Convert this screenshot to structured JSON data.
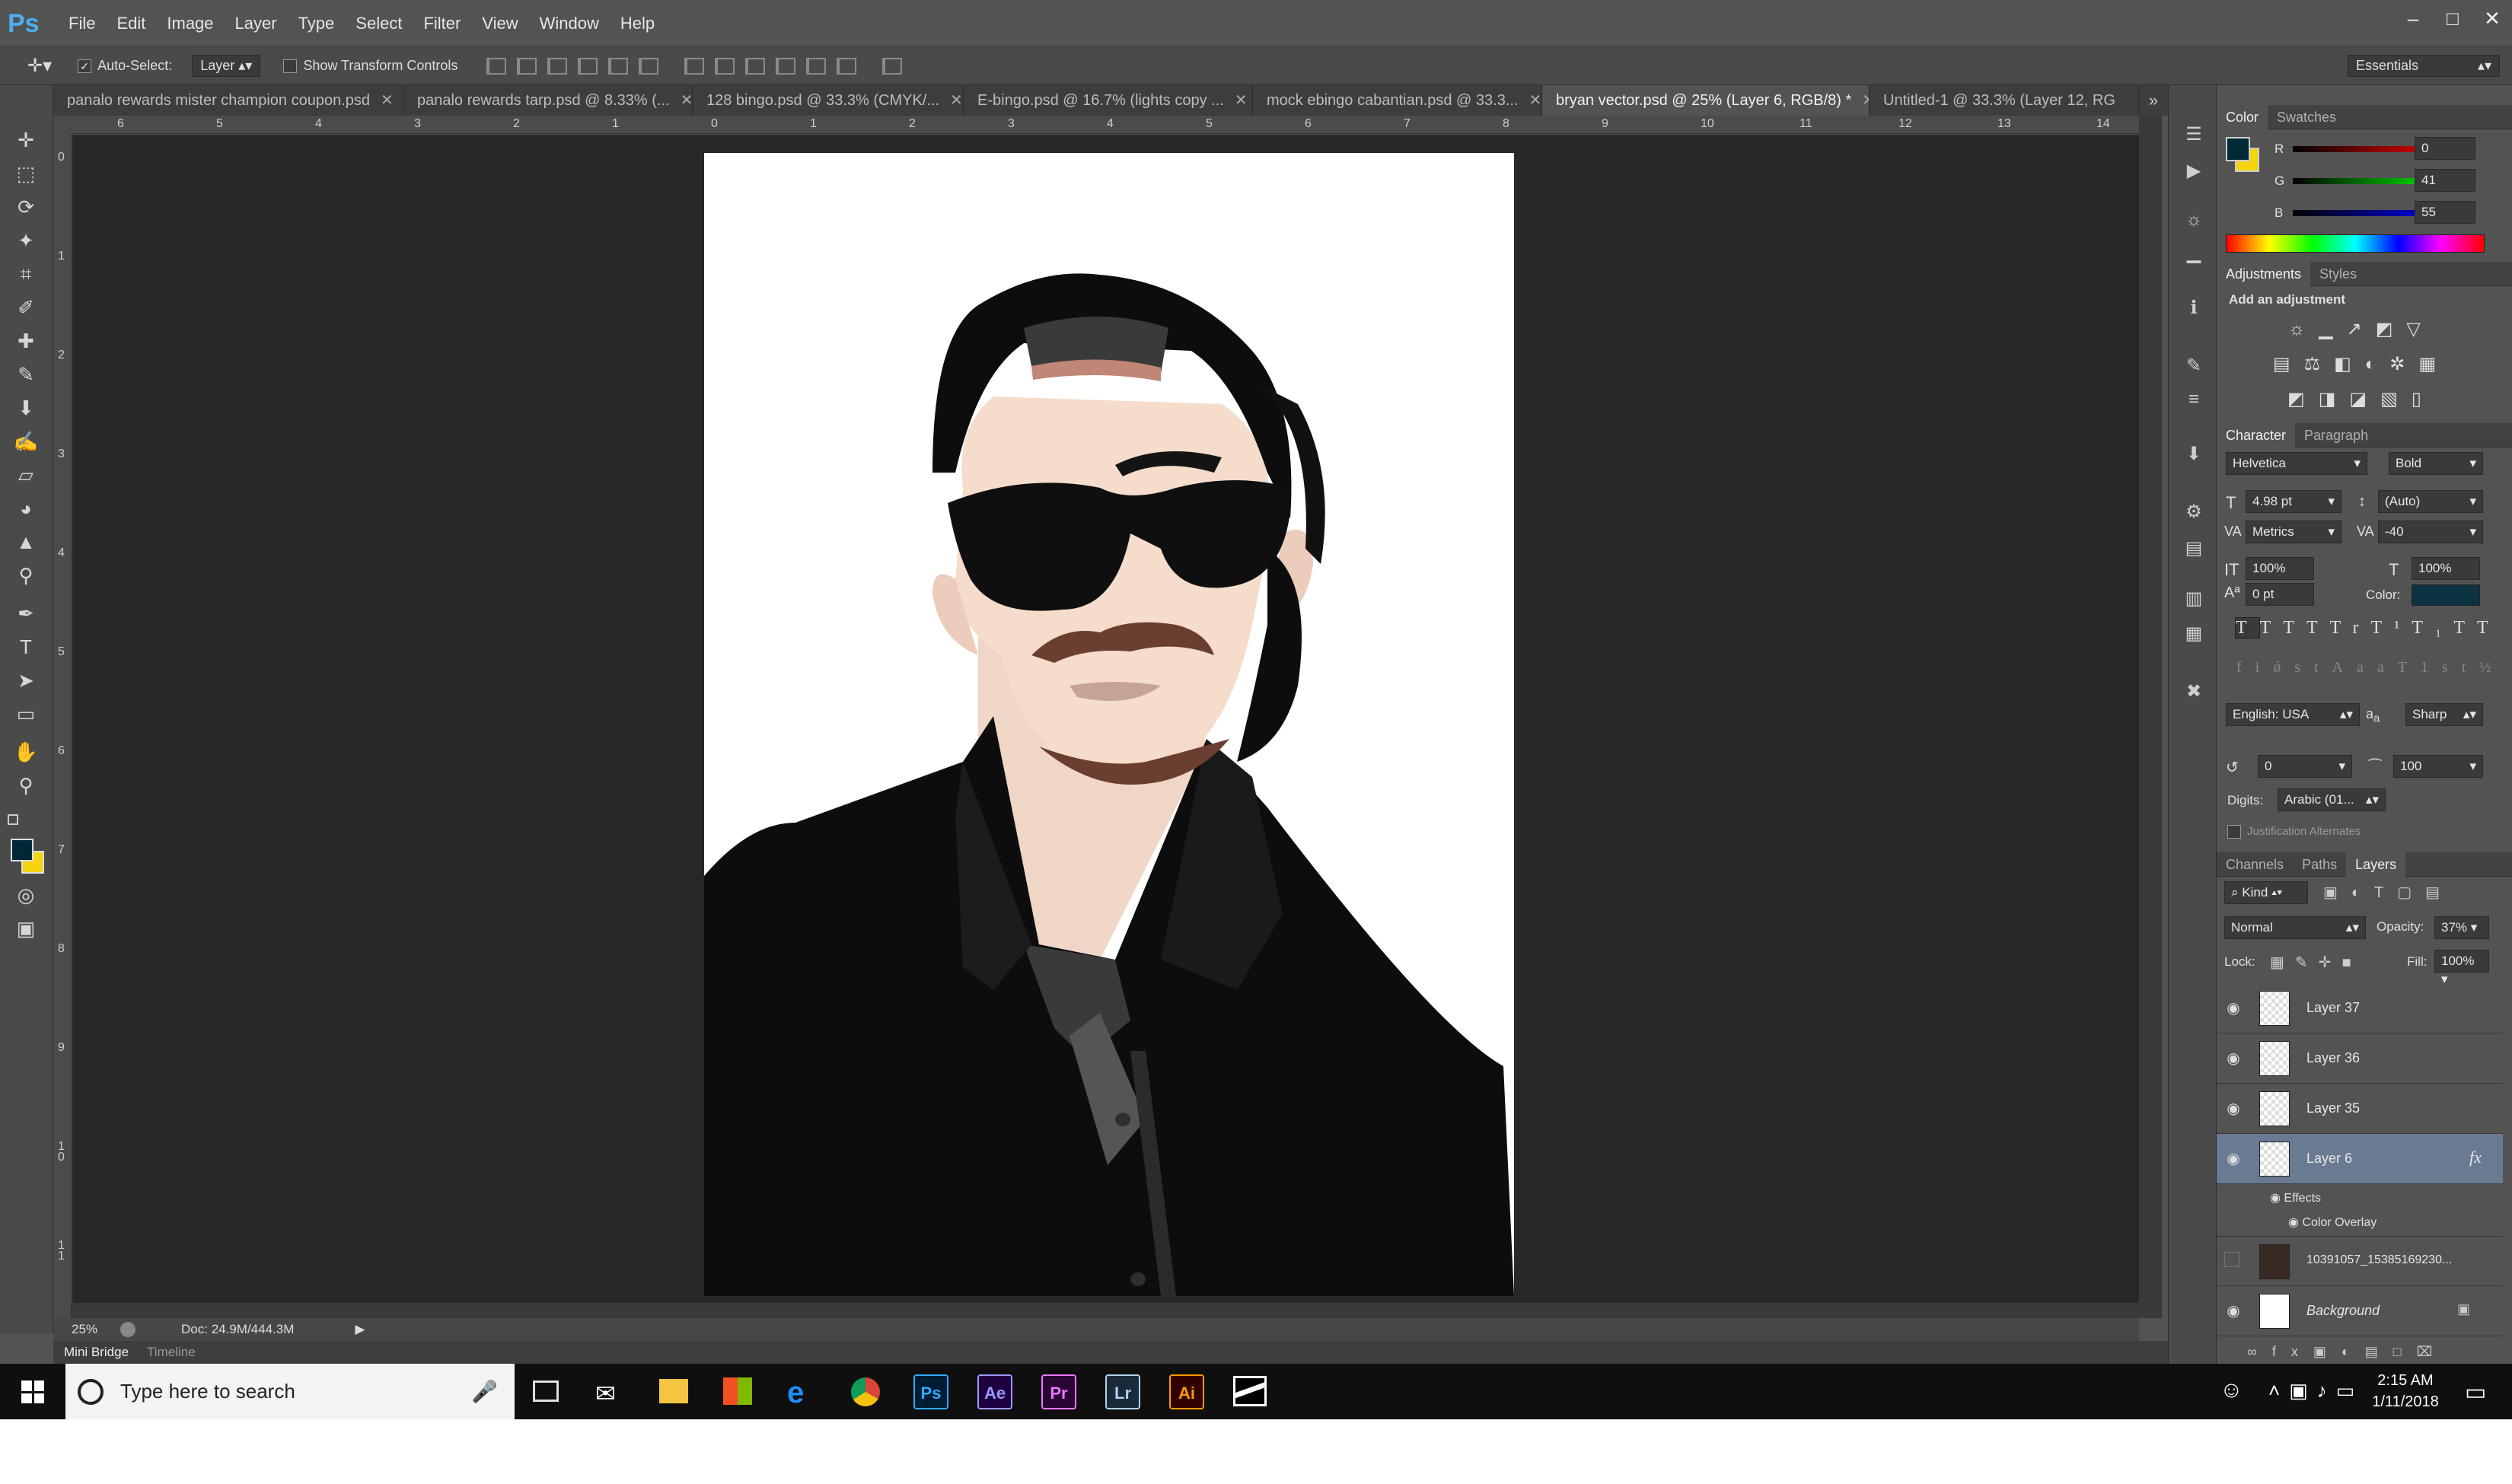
{
  "app": {
    "logo": "Ps"
  },
  "menu": [
    "File",
    "Edit",
    "Image",
    "Layer",
    "Type",
    "Select",
    "Filter",
    "View",
    "Window",
    "Help"
  ],
  "window_controls": [
    "–",
    "□",
    "✕"
  ],
  "options": {
    "auto_select_label": "Auto-Select:",
    "auto_select_value": "Layer",
    "show_transform_label": "Show Transform Controls",
    "workspace": "Essentials"
  },
  "tabs": [
    {
      "label": "panalo rewards mister champion coupon.psd",
      "active": false
    },
    {
      "label": "panalo rewards tarp.psd @ 8.33% (...",
      "active": false
    },
    {
      "label": "128 bingo.psd @ 33.3% (CMYK/...",
      "active": false
    },
    {
      "label": "E-bingo.psd @ 16.7% (lights copy ...",
      "active": false
    },
    {
      "label": "mock ebingo cabantian.psd @ 33.3...",
      "active": false
    },
    {
      "label": "bryan vector.psd @ 25% (Layer 6, RGB/8) *",
      "active": true
    },
    {
      "label": "Untitled-1 @ 33.3% (Layer 12, RG",
      "active": false
    }
  ],
  "ruler_top": [
    "6",
    "5",
    "4",
    "3",
    "2",
    "1",
    "0",
    "1",
    "2",
    "3",
    "4",
    "5",
    "6",
    "7",
    "8",
    "9",
    "10",
    "11",
    "12",
    "13",
    "14"
  ],
  "ruler_left": [
    "0",
    "1",
    "2",
    "3",
    "4",
    "5",
    "6",
    "7",
    "8",
    "9",
    "1\n0",
    "1\n1"
  ],
  "status": {
    "zoom": "25%",
    "doc": "Doc: 24.9M/444.3M"
  },
  "bottom_tabs": [
    "Mini Bridge",
    "Timeline"
  ],
  "color_panel": {
    "tabs": [
      "Color",
      "Swatches"
    ],
    "r": "0",
    "g": "41",
    "b": "55",
    "r_label": "R",
    "g_label": "G",
    "b_label": "B",
    "foreground": "#002937",
    "background": "#f5d410"
  },
  "adjustments": {
    "tabs": [
      "Adjustments",
      "Styles"
    ],
    "title": "Add an adjustment"
  },
  "character": {
    "tabs": [
      "Character",
      "Paragraph"
    ],
    "font": "Helvetica",
    "style": "Bold",
    "size": "4.98 pt",
    "leading": "(Auto)",
    "kerning": "Metrics",
    "tracking": "-40",
    "vscale": "100%",
    "hscale": "100%",
    "baseline": "0 pt",
    "color_label": "Color:",
    "language": "English: USA",
    "aa": "Sharp",
    "aa_prefix": "a",
    "aa_icon": "a",
    "val1": "0",
    "val2": "100",
    "digits_label": "Digits:",
    "digits": "Arabic (01...",
    "justification": "Justification Alternates",
    "text_color": "#0d3342"
  },
  "layers_panel": {
    "tabs": [
      "Channels",
      "Paths",
      "Layers"
    ],
    "kind": "Kind",
    "blend": "Normal",
    "opacity_label": "Opacity:",
    "opacity": "37%",
    "lock_label": "Lock:",
    "fill_label": "Fill:",
    "fill": "100%",
    "layers": [
      {
        "name": "Layer 37"
      },
      {
        "name": "Layer 36"
      },
      {
        "name": "Layer 35"
      },
      {
        "name": "Layer 6"
      },
      {
        "name": "10391057_15385169230..."
      },
      {
        "name": "Background"
      }
    ],
    "effects": "Effects",
    "color_overlay": "Color Overlay",
    "fx": "fx"
  },
  "taskbar": {
    "search_placeholder": "Type here to search",
    "apps": [
      "Ps",
      "Ae",
      "Pr",
      "Lr",
      "Ai"
    ],
    "time": "2:15 AM",
    "date": "1/11/2018"
  }
}
